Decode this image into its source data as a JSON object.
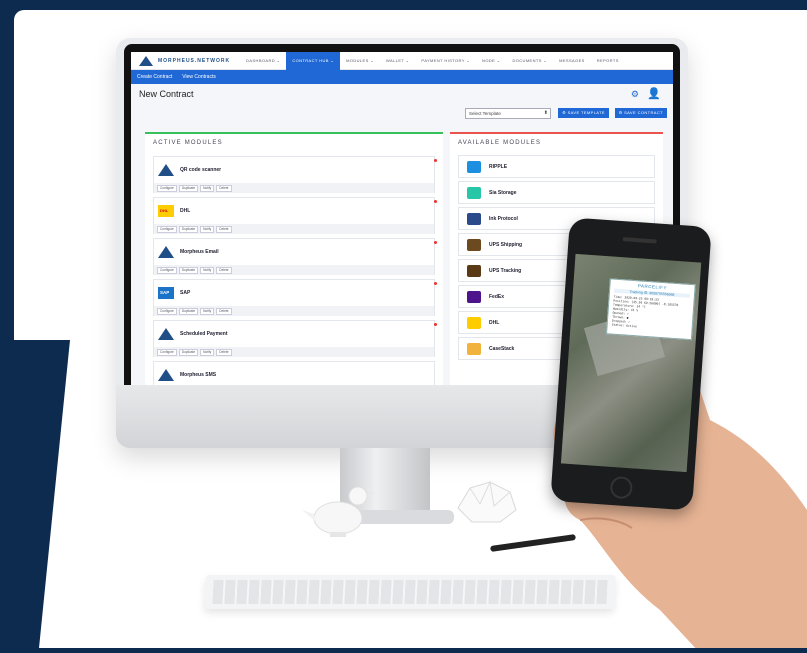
{
  "app": {
    "brand": "MORPHEUS.NETWORK"
  },
  "topnav": {
    "items": [
      {
        "label": "DASHBOARD ⌄"
      },
      {
        "label": "CONTRACT HUB ⌄",
        "active": true
      },
      {
        "label": "MODULES ⌄"
      },
      {
        "label": "WALLET ⌄"
      },
      {
        "label": "PAYMENT HISTORY ⌄"
      },
      {
        "label": "NODE ⌄"
      },
      {
        "label": "DOCUMENTS ⌄"
      },
      {
        "label": "MESSAGES"
      },
      {
        "label": "REPORTS"
      }
    ]
  },
  "subnav": {
    "create_contract": "Create Contract",
    "view_contracts": "View Contracts"
  },
  "page": {
    "title": "New Contract",
    "select_template": "Select Template",
    "save_template": "SAVE TEMPLATE",
    "save_contract": "SAVE CONTRACT"
  },
  "active_modules": {
    "heading": "ACTIVE MODULES",
    "actions": [
      "Configure",
      "Duplicate",
      "Notify",
      "Delete"
    ],
    "items": [
      {
        "name": "QR code scanner",
        "icon": "morpheus-icon"
      },
      {
        "name": "DHL",
        "icon": "dhl-icon"
      },
      {
        "name": "Morpheus Email",
        "icon": "morpheus-icon"
      },
      {
        "name": "SAP",
        "icon": "sap-icon"
      },
      {
        "name": "Scheduled Payment",
        "icon": "morpheus-icon"
      },
      {
        "name": "Morpheus SMS",
        "icon": "morpheus-icon"
      }
    ]
  },
  "available_modules": {
    "heading": "AVAILABLE MODULES",
    "items": [
      {
        "name": "RIPPLE",
        "icon": "ripple-icon",
        "color": "#1c8fe0"
      },
      {
        "name": "Sia Storage",
        "icon": "sia-icon",
        "color": "#27c6a6"
      },
      {
        "name": "Ink Protocol",
        "icon": "ink-icon",
        "color": "#2b4a8a"
      },
      {
        "name": "UPS Shipping",
        "icon": "ups-icon",
        "color": "#6b4a20"
      },
      {
        "name": "UPS Tracking",
        "icon": "ups-icon",
        "color": "#5a3a14"
      },
      {
        "name": "FedEx",
        "icon": "fedex-icon",
        "color": "#4d148c"
      },
      {
        "name": "DHL",
        "icon": "dhl-icon",
        "color": "#ffcc00"
      },
      {
        "name": "CaseStack",
        "icon": "casestack-icon",
        "color": "#f2b33d"
      }
    ]
  },
  "phone": {
    "popup_brand": "PARCELIFY",
    "tracking": "Tracking ID: 4008755566968",
    "lines": [
      "Time: 2020-09-25 09:18:33",
      "Position: [45.50 69.56000] -8.105570",
      "Temperature: 24 °C",
      "Humidity: 41 %",
      "Opened: ✓",
      "Thrown: ●",
      "Dropped: ✓",
      "Status: Active"
    ]
  },
  "colors": {
    "brand_blue": "#1f68d6",
    "navy": "#0d2a4f",
    "active_green": "#36c15a",
    "available_red": "#e9544f"
  }
}
